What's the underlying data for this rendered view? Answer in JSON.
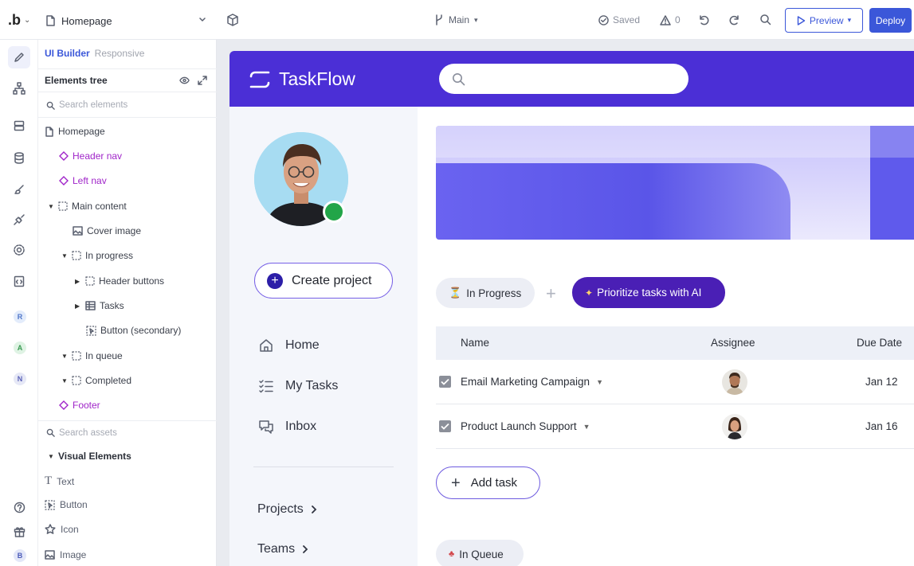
{
  "toolbar": {
    "logo": ".b",
    "page": "Homepage",
    "branch": "Main",
    "saved": "Saved",
    "warnings": "0",
    "preview": "Preview",
    "deploy": "Deploy"
  },
  "rail": {
    "avatars": [
      "R",
      "A",
      "N",
      "B"
    ]
  },
  "panel": {
    "tabs": [
      "UI Builder",
      "Responsive"
    ],
    "tree_title": "Elements tree",
    "search_placeholder": "Search elements",
    "tree": [
      "Homepage",
      "Header nav",
      "Left nav",
      "Main content",
      "Cover image",
      "In progress",
      "Header buttons",
      "Tasks",
      "Button (secondary)",
      "In queue",
      "Completed",
      "Footer"
    ],
    "assets_placeholder": "Search assets",
    "assets_section": "Visual Elements",
    "assets": [
      "Text",
      "Button",
      "Icon",
      "Image"
    ]
  },
  "app": {
    "brand": "TaskFlow",
    "create_project": "Create project",
    "nav": [
      "Home",
      "My Tasks",
      "Inbox"
    ],
    "nav_secondary": [
      "Projects",
      "Teams"
    ],
    "chip_progress": "In Progress",
    "chip_ai": "Prioritize tasks with AI",
    "table": {
      "columns": [
        "Name",
        "Assignee",
        "Due Date"
      ],
      "rows": [
        {
          "name": "Email Marketing Campaign",
          "due": "Jan 12"
        },
        {
          "name": "Product Launch Support",
          "due": "Jan 16"
        }
      ]
    },
    "add_task": "Add task",
    "chip_queue": "In Queue"
  },
  "colors": {
    "accent": "#3b57d9",
    "app_header": "#4b2fd6",
    "ai_chip": "#4a1fb5",
    "component": "#a025c9",
    "online": "#22a548"
  }
}
